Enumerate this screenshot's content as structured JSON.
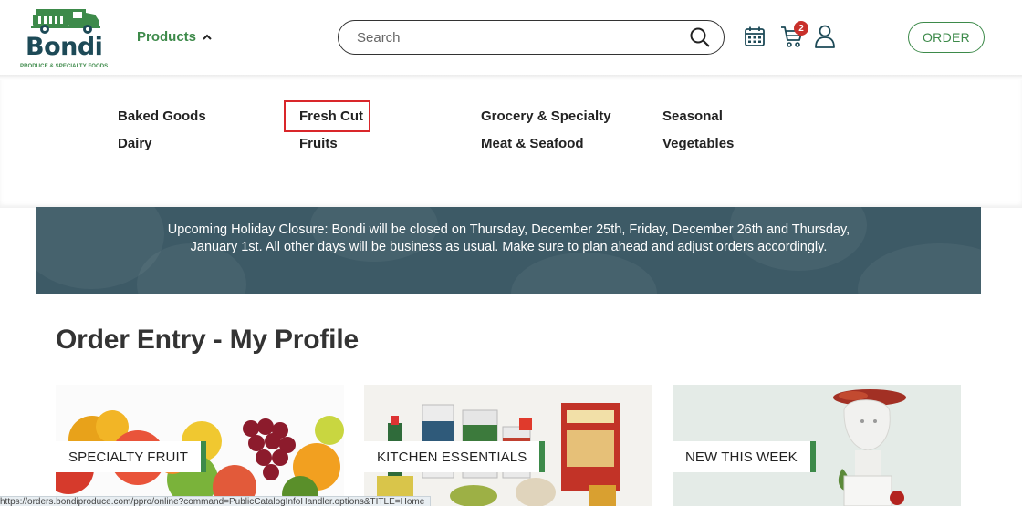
{
  "header": {
    "logo_word": "Bondi",
    "logo_tagline": "PRODUCE & SPECIALTY FOODS",
    "products_label": "Products",
    "search_placeholder": "Search",
    "cart_count": "2",
    "order_label": "ORDER"
  },
  "menu": {
    "items": [
      {
        "label": "Baked Goods"
      },
      {
        "label": "Dairy"
      },
      {
        "label": "Fresh Cut"
      },
      {
        "label": "Fruits"
      },
      {
        "label": "Grocery & Specialty"
      },
      {
        "label": "Meat & Seafood"
      },
      {
        "label": "Seasonal"
      },
      {
        "label": "Vegetables"
      }
    ],
    "highlighted": "Fresh Cut"
  },
  "banner": {
    "text": "Upcoming Holiday Closure: Bondi will be closed on Thursday, December 25th, Friday, December 26th and Thursday, January 1st. All other days will be business as usual. Make sure to plan ahead and adjust orders accordingly."
  },
  "main": {
    "title": "Order Entry - My Profile",
    "cards": [
      {
        "label": "SPECIALTY FRUIT"
      },
      {
        "label": "KITCHEN ESSENTIALS"
      },
      {
        "label": "NEW THIS WEEK"
      }
    ]
  },
  "status_url": "https://orders.bondiproduce.com/ppro/online?command=PublicCatalogInfoHandler.options&TITLE=Home",
  "colors": {
    "brand_green": "#3d8a4a",
    "brand_navy": "#1d4a57",
    "banner_bg": "#3d5a66",
    "badge_red": "#c8302b",
    "highlight_red": "#d9262a"
  }
}
